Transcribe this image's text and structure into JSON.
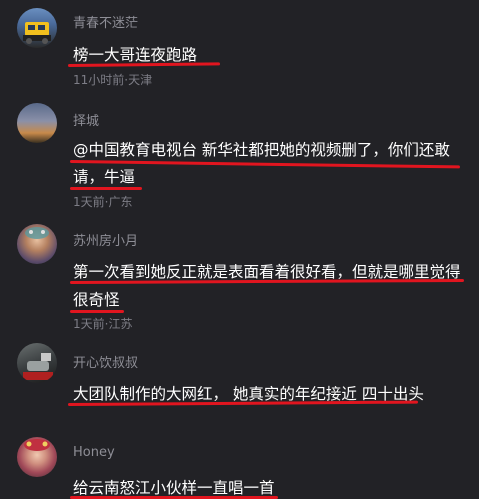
{
  "comments": [
    {
      "username": "青春不迷茫",
      "lines": [
        "榜一大哥连夜跑路"
      ],
      "meta": "11小时前·天津"
    },
    {
      "username": "择城",
      "lines": [
        "@中国教育电视台 新华社都把她的视频删了，你们还敢",
        "请，牛逼"
      ],
      "meta": "1天前·广东"
    },
    {
      "username": "苏州房小月",
      "lines": [
        "第一次看到她反正就是表面看着很好看，但就是哪里觉得",
        "很奇怪"
      ],
      "meta": "1天前·江苏"
    },
    {
      "username": "开心饮叔叔",
      "lines": [
        "大团队制作的大网红， 她真实的年纪接近 四十出头"
      ],
      "meta": ""
    },
    {
      "username": "Honey",
      "lines": [
        "给云南怒江小伙样一直唱一首"
      ],
      "meta": ""
    }
  ],
  "colors": {
    "background": "#222226",
    "annotation_underline": "#e1151f"
  }
}
